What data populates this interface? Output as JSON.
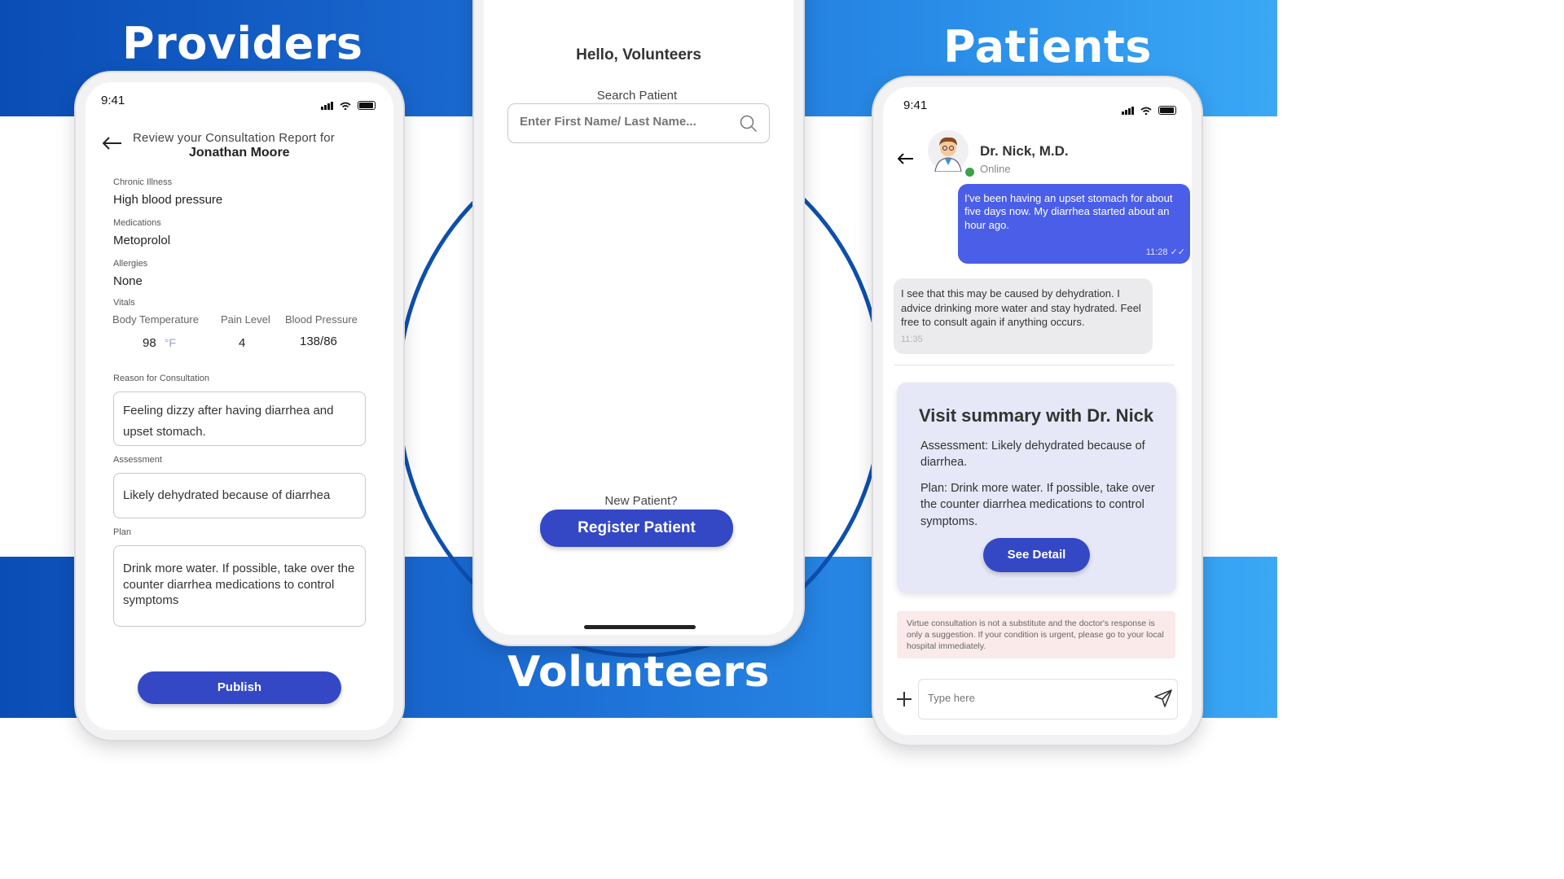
{
  "labels": {
    "providers": "Providers",
    "patients": "Patients",
    "volunteers": "Volunteers"
  },
  "provider": {
    "status_time": "9:41",
    "header_line1": "Review your Consultation Report for",
    "header_name": "Jonathan Moore",
    "chronic_label": "Chronic Illness",
    "chronic_value": "High blood pressure",
    "med_label": "Medications",
    "med_value": "Metoprolol",
    "allergy_label": "Allergies",
    "allergy_value": "None",
    "vitals_label": "Vitals",
    "temp_label": "Body Temperature",
    "pain_label": "Pain Level",
    "bp_label": "Blood Pressure",
    "temp_value": "98",
    "temp_unit": "°F",
    "pain_value": "4",
    "bp_value": "138/86",
    "reason_label": "Reason for Consultation",
    "reason_value": "Feeling dizzy after having diarrhea and upset stomach.",
    "assess_label": "Assessment",
    "assess_value": "Likely dehydrated because of diarrhea",
    "plan_label": "Plan",
    "plan_value": "Drink more water. If possible, take over the counter diarrhea medications to control symptoms",
    "publish": "Publish"
  },
  "volunteer": {
    "greeting": "Hello, Volunteers",
    "search_label": "Search Patient",
    "search_placeholder": "Enter First Name/ Last Name...",
    "new_patient": "New Patient?",
    "register": "Register Patient"
  },
  "patient": {
    "status_time": "9:41",
    "doctor_name": "Dr. Nick, M.D.",
    "doctor_status": "Online",
    "msg1": "I've been having an upset stomach for about five days now. My diarrhea started about an hour ago.",
    "msg1_time": "11:28",
    "msg2": "I see that this may be caused by dehydration. I advice drinking more water and stay hydrated. Feel free to consult again if anything occurs.",
    "msg2_time": "11:35",
    "summary_title": "Visit summary with Dr. Nick",
    "summary_assessment": "Assessment: Likely dehydrated because of diarrhea.",
    "summary_plan": "Plan: Drink more water. If possible, take over the counter diarrhea medications to control symptoms.",
    "see_detail": "See Detail",
    "disclaimer": "Virtue consultation is not a substitute and the doctor's response is only a suggestion. If your condition is urgent, please go to your local hospital immediately.",
    "input_placeholder": "Type here"
  },
  "colors": {
    "accent": "#3448c5",
    "chat_blue": "#4a5ee8",
    "band_blue": "#1d6fd6",
    "ring": "#0d4fae"
  }
}
